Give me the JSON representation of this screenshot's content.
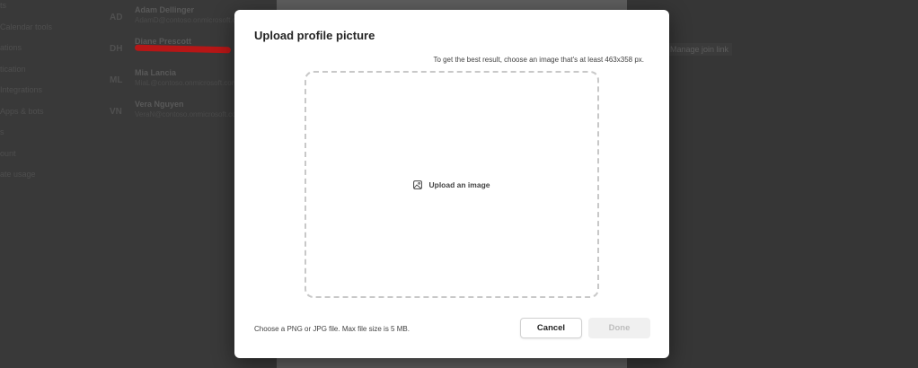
{
  "background": {
    "nav_items": [
      "ts",
      "Calendar tools",
      "ations",
      "tication",
      "Integrations",
      "Apps & bots",
      "s",
      "ount",
      "ate usage"
    ],
    "members": [
      {
        "initials": "AD",
        "name": "Adam Dellinger",
        "email": "AdamD@contoso.onmicrosoft.com"
      },
      {
        "initials": "DH",
        "name": "Diane Prescott",
        "email": ""
      },
      {
        "initials": "ML",
        "name": "Mia Lancia",
        "email": "MiaL@contoso.onmicrosoft.com"
      },
      {
        "initials": "VN",
        "name": "Vera Nguyen",
        "email": "VeraN@contoso.onmicrosoft.com"
      }
    ],
    "right_link": "Manage join link"
  },
  "dialog": {
    "title": "Upload profile picture",
    "hint": "To get the best result, choose an image that's at least 463x358 px.",
    "upload_label": "Upload an image",
    "footer_note": "Choose a PNG or JPG file. Max file size is 5 MB.",
    "cancel_label": "Cancel",
    "done_label": "Done"
  },
  "icons": {
    "upload": "image-icon"
  },
  "colors": {
    "annotation": "#d11a1a",
    "dialog_bg": "#ffffff",
    "dropzone_border": "#c8c8c8",
    "disabled_button": "#f0f0f0"
  }
}
